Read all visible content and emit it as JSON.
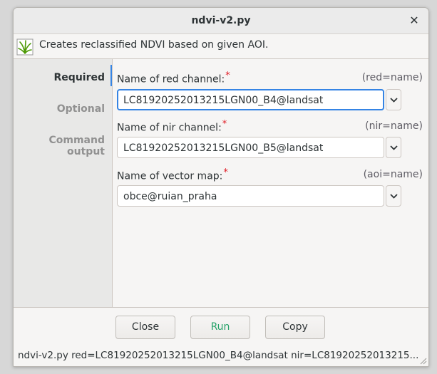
{
  "window": {
    "title": "ndvi-v2.py"
  },
  "description": "Creates reclassified NDVI based on given AOI.",
  "sidebar": {
    "items": [
      {
        "label": "Required"
      },
      {
        "label": "Optional"
      },
      {
        "label": "Command output"
      }
    ]
  },
  "fields": [
    {
      "label": "Name of red channel:",
      "hint": "(red=name)",
      "value": "LC81920252013215LGN00_B4@landsat"
    },
    {
      "label": "Name of nir channel:",
      "hint": "(nir=name)",
      "value": "LC81920252013215LGN00_B5@landsat"
    },
    {
      "label": "Name of vector map:",
      "hint": "(aoi=name)",
      "value": "obce@ruian_praha"
    }
  ],
  "required_marker": "*",
  "buttons": {
    "close": "Close",
    "run": "Run",
    "copy": "Copy"
  },
  "status": "ndvi-v2.py red=LC81920252013215LGN00_B4@landsat nir=LC81920252013215...",
  "colors": {
    "accent": "#3584e4",
    "run": "#26a269",
    "required": "#e01b24"
  },
  "icons": {
    "app": "grass-icon",
    "close": "close-icon",
    "dropdown": "chevron-down-icon"
  }
}
